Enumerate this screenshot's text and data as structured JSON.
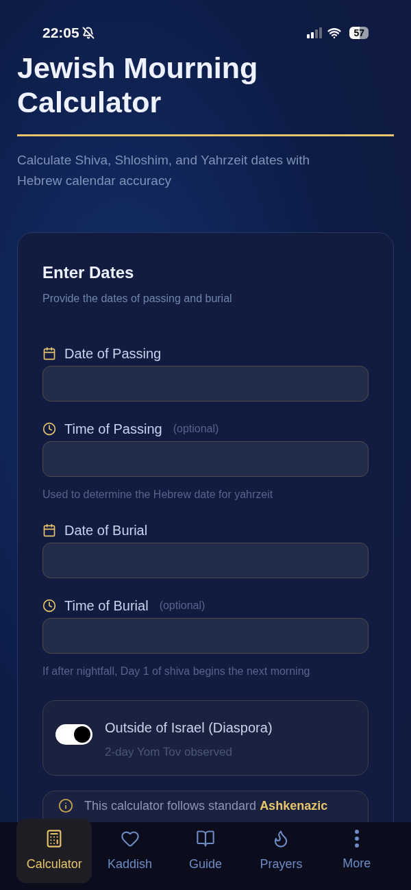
{
  "status_bar": {
    "time": "22:05",
    "battery": "57",
    "silent": true
  },
  "header": {
    "title": "Jewish Mourning Calculator",
    "subtitle": "Calculate Shiva, Shloshim, and Yahrzeit dates with Hebrew calendar accuracy"
  },
  "card": {
    "title": "Enter Dates",
    "subtitle": "Provide the dates of passing and burial",
    "fields": [
      {
        "kind": "date",
        "label": "Date of Passing"
      },
      {
        "kind": "time",
        "label": "Time of Passing",
        "optional": "(optional)",
        "hint": "Used to determine the Hebrew date for yahrzeit"
      },
      {
        "kind": "date",
        "label": "Date of Burial"
      },
      {
        "kind": "time",
        "label": "Time of Burial",
        "optional": "(optional)",
        "hint": "If after nightfall, Day 1 of shiva begins the next morning"
      }
    ],
    "toggle": {
      "label": "Outside of Israel (Diaspora)",
      "description": "2-day Yom Tov observed",
      "on": true
    },
    "info": "This calculator follows standard **Ashkenazic**"
  },
  "tab_bar": [
    {
      "kind": "calculator",
      "label": "Calculator",
      "selected": true
    },
    {
      "kind": "heart",
      "label": "Kaddish",
      "selected": false
    },
    {
      "kind": "book",
      "label": "Guide",
      "selected": false
    },
    {
      "kind": "flame",
      "label": "Prayers",
      "selected": false
    },
    {
      "kind": "more",
      "label": "More",
      "selected": false
    }
  ]
}
